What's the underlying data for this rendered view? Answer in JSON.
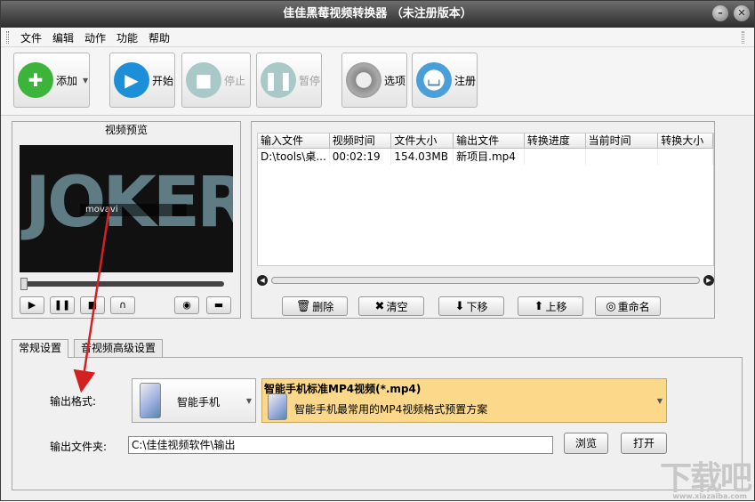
{
  "window": {
    "title": "佳佳黑莓视频转换器 （未注册版本）",
    "min": "–",
    "close": "✕"
  },
  "menu": [
    "文件",
    "编辑",
    "动作",
    "功能",
    "帮助"
  ],
  "toolbar": {
    "add": "添加",
    "start": "开始",
    "stop": "停止",
    "pause": "暂停",
    "options": "选项",
    "register": "注册"
  },
  "preview": {
    "title": "视频预览",
    "video_text": "JOKER",
    "watermark": "movavi",
    "controls": {
      "play": "▶",
      "pause": "❚❚",
      "stop": "■",
      "headphones": "∩",
      "snapshot": "◉",
      "folder": "▬"
    }
  },
  "file_list": {
    "columns": [
      "输入文件",
      "视频时间",
      "文件大小",
      "输出文件",
      "转换进度",
      "当前时间",
      "转换大小"
    ],
    "rows": [
      [
        "D:\\tools\\桌...",
        "00:02:19",
        "154.03MB",
        "新项目.mp4",
        "",
        "",
        ""
      ]
    ]
  },
  "actions": {
    "delete": "删除",
    "clear": "清空",
    "move_down": "下移",
    "move_up": "上移",
    "rename": "重命名"
  },
  "tabs": [
    "常规设置",
    "音视频高级设置"
  ],
  "settings": {
    "format_label": "输出格式:",
    "device": "智能手机",
    "preset_title": "智能手机标准MP4视频(*.mp4)",
    "preset_desc": "智能手机最常用的MP4视频格式预置方案",
    "folder_label": "输出文件夹:",
    "folder_path": "C:\\佳佳视频软件\\输出",
    "browse": "浏览",
    "open": "打开"
  },
  "brand": {
    "logo": "下载吧",
    "url": "www.xiazaiba.com"
  },
  "colors": {
    "add_icon": "#3cb43c",
    "start_icon": "#1d8fd8",
    "disabled_icon": "#a9c8c8",
    "arrow": "#d42020",
    "preset_bg": "#fcd98a"
  }
}
